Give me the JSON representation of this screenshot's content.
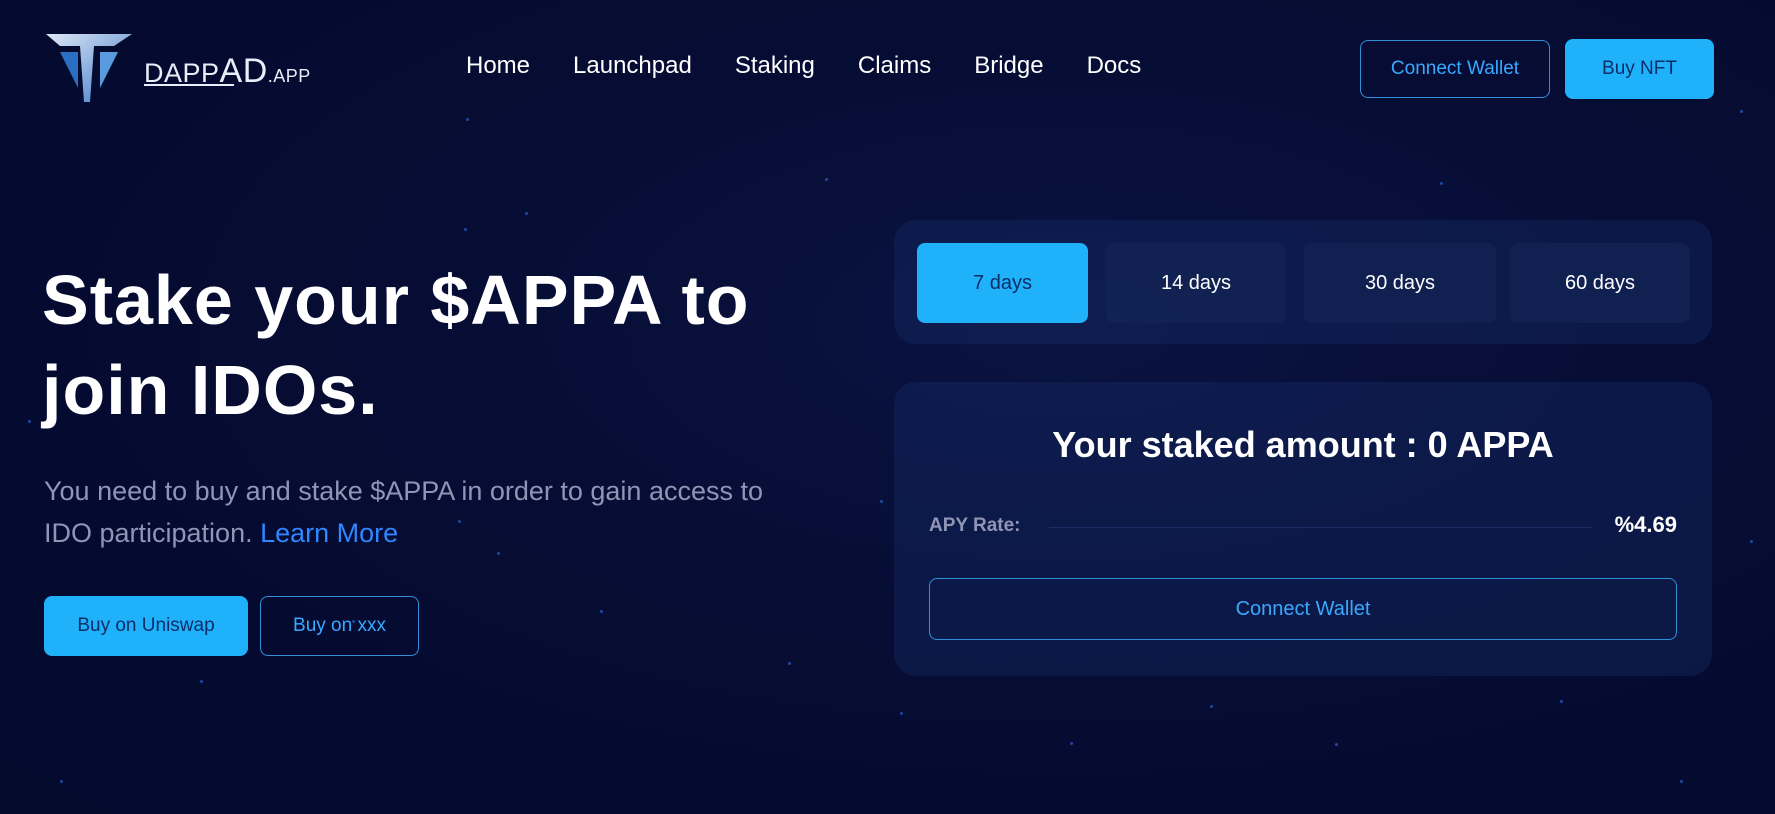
{
  "brand": {
    "logo_prefix": "DAPP",
    "logo_big": "A",
    "logo_mid": "D",
    "logo_suffix": ".APP"
  },
  "nav": {
    "items": [
      "Home",
      "Launchpad",
      "Staking",
      "Claims",
      "Bridge",
      "Docs"
    ]
  },
  "header": {
    "connect_wallet_label": "Connect Wallet",
    "buy_nft_label": "Buy NFT"
  },
  "hero": {
    "title_line1": "Stake your $APPA to",
    "title_line2": "join IDOs.",
    "description": "You need to buy and stake $APPA in order to gain access to IDO participation.",
    "learn_more": "Learn More",
    "buy_uniswap_label": "Buy on Uniswap",
    "buy_xxx_label": "Buy on xxx"
  },
  "staking": {
    "tabs": [
      {
        "label": "7 days",
        "active": true
      },
      {
        "label": "14 days",
        "active": false
      },
      {
        "label": "30 days",
        "active": false
      },
      {
        "label": "60 days",
        "active": false
      }
    ],
    "staked_amount_text": "Your staked amount : 0 APPA",
    "apy_label": "APY Rate:",
    "apy_value": "%4.69",
    "connect_wallet_label": "Connect Wallet"
  },
  "colors": {
    "background": "#060c33",
    "accent": "#1fb2fb",
    "link": "#2f86ff",
    "outline": "#2f8fd6"
  }
}
